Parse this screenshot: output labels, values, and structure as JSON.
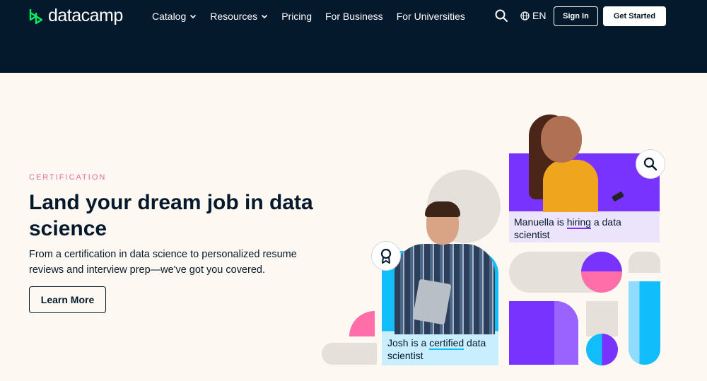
{
  "header": {
    "logo_text": "datacamp",
    "nav": [
      {
        "label": "Catalog",
        "has_dropdown": true
      },
      {
        "label": "Resources",
        "has_dropdown": true
      },
      {
        "label": "Pricing",
        "has_dropdown": false
      },
      {
        "label": "For Business",
        "has_dropdown": false
      },
      {
        "label": "For Universities",
        "has_dropdown": false
      }
    ],
    "language": "EN",
    "sign_in": "Sign In",
    "get_started": "Get Started"
  },
  "hero": {
    "eyebrow": "CERTIFICATION",
    "headline": "Land your dream job in data science",
    "description": "From a certification in data science to personalized resume reviews and interview prep—we've got you covered.",
    "cta": "Learn More"
  },
  "illustration": {
    "caption_manuella_pre": "Manuella is ",
    "caption_manuella_hl": "hiring",
    "caption_manuella_post": " a data scientist",
    "caption_josh_pre": "Josh is a ",
    "caption_josh_hl": "certified",
    "caption_josh_post": " data scientist"
  },
  "colors": {
    "navy": "#05192d",
    "brand_green": "#03ef62",
    "cream": "#fdf8f1",
    "purple": "#7933ff",
    "pink": "#ff6ea9",
    "blue": "#12bdfb",
    "eyebrow_pink": "#e46a9d"
  }
}
